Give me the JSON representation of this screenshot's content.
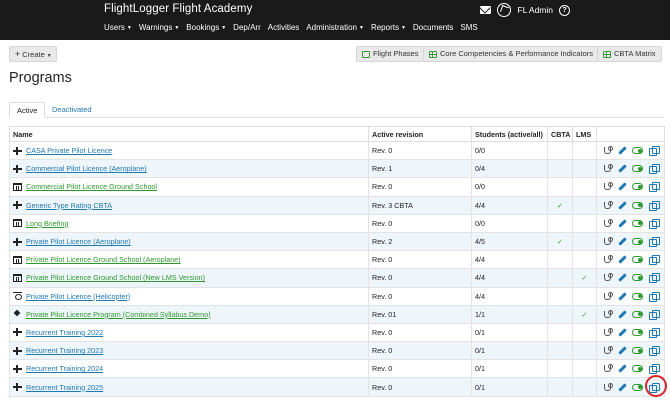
{
  "header": {
    "brand": "FlightLogger Flight Academy",
    "user_label": "FL Admin",
    "help_glyph": "?",
    "menu": [
      {
        "label": "Users",
        "dropdown": true
      },
      {
        "label": "Warnings",
        "dropdown": true
      },
      {
        "label": "Bookings",
        "dropdown": true
      },
      {
        "label": "Dep/Arr",
        "dropdown": false
      },
      {
        "label": "Activities",
        "dropdown": false
      },
      {
        "label": "Administration",
        "dropdown": true
      },
      {
        "label": "Reports",
        "dropdown": true
      },
      {
        "label": "Documents",
        "dropdown": false
      },
      {
        "label": "SMS",
        "dropdown": false
      }
    ]
  },
  "toolbar": {
    "create_label": "Create",
    "flight_phases_label": "Flight Phases",
    "core_competencies_label": "Core Competencies & Performance Indicators",
    "cbta_matrix_label": "CBTA Matrix"
  },
  "page": {
    "title": "Programs",
    "tabs": [
      "Active",
      "Deactivated"
    ]
  },
  "table": {
    "columns": [
      "Name",
      "Active revision",
      "Students (active/all)",
      "CBTA",
      "LMS",
      ""
    ],
    "rows": [
      {
        "icon": "plane-icon",
        "name": "CASA Private Pilot Licence",
        "revision": "Rev. 0",
        "students": "0/0",
        "cbta": false,
        "lms": false,
        "ground": false
      },
      {
        "icon": "plane-icon",
        "name": "Commercial Pilot Licence (Aeroplane)",
        "revision": "Rev. 1",
        "students": "0/4",
        "cbta": false,
        "lms": false,
        "ground": false
      },
      {
        "icon": "building-icon",
        "name": "Commercial Pilot Licence Ground School",
        "revision": "Rev. 0",
        "students": "0/0",
        "cbta": false,
        "lms": false,
        "ground": true
      },
      {
        "icon": "plane-icon",
        "name": "Generic Type Rating CBTA",
        "revision": "Rev. 3 CBTA",
        "students": "4/4",
        "cbta": true,
        "lms": false,
        "ground": false
      },
      {
        "icon": "building-icon",
        "name": "Long Briefing",
        "revision": "Rev. 0",
        "students": "0/0",
        "cbta": false,
        "lms": false,
        "ground": true
      },
      {
        "icon": "plane-icon",
        "name": "Private Pilot Licence (Aeroplane)",
        "revision": "Rev. 2",
        "students": "4/5",
        "cbta": true,
        "lms": false,
        "ground": false
      },
      {
        "icon": "building-icon",
        "name": "Private Pilot Licence Ground School (Aeroplane)",
        "revision": "Rev. 0",
        "students": "4/4",
        "cbta": false,
        "lms": false,
        "ground": true
      },
      {
        "icon": "building-icon",
        "name": "Private Pilot Licence Ground School (New LMS Version)",
        "revision": "Rev. 0",
        "students": "4/4",
        "cbta": false,
        "lms": true,
        "ground": true
      },
      {
        "icon": "helicopter-icon",
        "name": "Private Pilot Licence (Helicopter)",
        "revision": "Rev. 0",
        "students": "4/4",
        "cbta": false,
        "lms": false,
        "ground": false
      },
      {
        "icon": "layers-icon",
        "name": "Private Pilot Licence Program (Combined Syllabus Demo)",
        "revision": "Rev. 01",
        "students": "1/1",
        "cbta": false,
        "lms": true,
        "ground": true
      },
      {
        "icon": "plane-icon",
        "name": "Recurrent Training 2022",
        "revision": "Rev. 0",
        "students": "0/1",
        "cbta": false,
        "lms": false,
        "ground": false
      },
      {
        "icon": "plane-icon",
        "name": "Recurrent Training 2023",
        "revision": "Rev. 0",
        "students": "0/1",
        "cbta": false,
        "lms": false,
        "ground": false
      },
      {
        "icon": "plane-icon",
        "name": "Recurrent Training 2024",
        "revision": "Rev. 0",
        "students": "0/1",
        "cbta": false,
        "lms": false,
        "ground": false
      },
      {
        "icon": "plane-icon",
        "name": "Recurrent Training 2025",
        "revision": "Rev. 0",
        "students": "0/1",
        "cbta": false,
        "lms": false,
        "ground": false
      }
    ],
    "check_glyph": "✓"
  },
  "colors": {
    "header_bg": "#1a1a1a",
    "link_blue": "#1e78b4",
    "ground_green": "#2e9a2e",
    "row_alt": "#eef5fb",
    "highlight_red": "#d9262b"
  }
}
